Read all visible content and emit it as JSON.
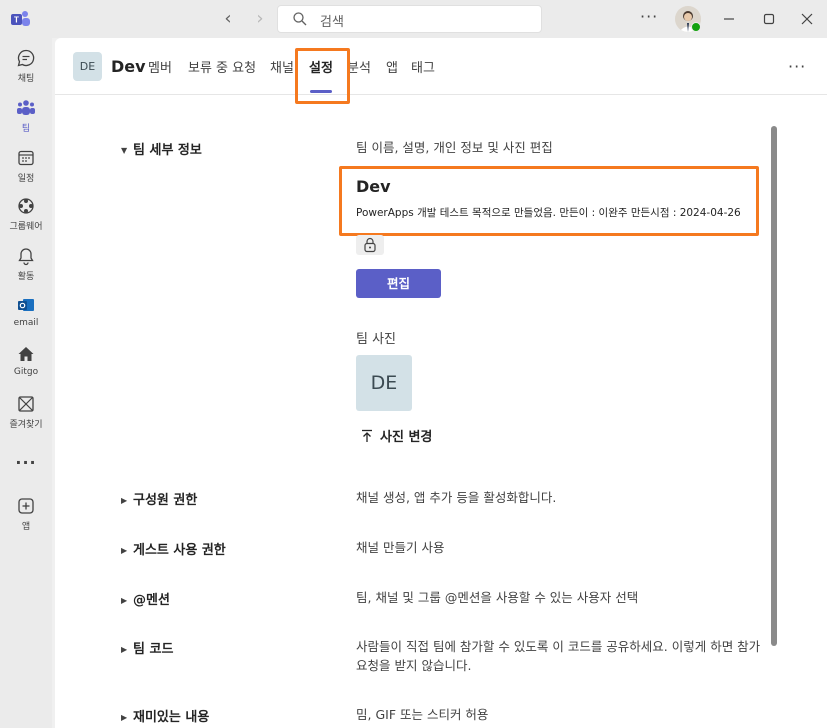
{
  "titlebar": {
    "search_placeholder": "검색",
    "more": "···"
  },
  "rail": {
    "items": [
      {
        "label": "채팅",
        "icon": "chat-icon"
      },
      {
        "label": "팀",
        "icon": "teams-icon"
      },
      {
        "label": "일정",
        "icon": "calendar-icon"
      },
      {
        "label": "그룹웨어",
        "icon": "groupware-icon"
      },
      {
        "label": "활동",
        "icon": "bell-icon"
      },
      {
        "label": "email",
        "icon": "outlook-icon"
      },
      {
        "label": "Gitgo",
        "icon": "home-icon"
      },
      {
        "label": "즐겨찾기",
        "icon": "favorites-icon"
      },
      {
        "label": "···",
        "icon": "more-icon"
      },
      {
        "label": "앱",
        "icon": "add-app-icon"
      }
    ]
  },
  "header": {
    "team_initials": "DE",
    "team_name": "Dev",
    "tabs": [
      {
        "label": "멤버"
      },
      {
        "label": "보류 중 요청"
      },
      {
        "label": "채널"
      },
      {
        "label": "설정"
      },
      {
        "label": "분석"
      },
      {
        "label": "앱"
      },
      {
        "label": "태그"
      }
    ],
    "more": "···"
  },
  "settings": {
    "details": {
      "title": "팀 세부 정보",
      "description": "팀 이름, 설명, 개인 정보 및 사진 편집",
      "team_name": "Dev",
      "team_description": "PowerApps 개발 테스트 목적으로 만들었음. 만든이 : 이완주 만든시점 : 2024-04-26",
      "edit_label": "편집",
      "photo_label": "팀 사진",
      "photo_initials": "DE",
      "change_photo_label": "사진 변경"
    },
    "rows": [
      {
        "title": "구성원 권한",
        "description": "채널 생성, 앱 추가 등을 활성화합니다."
      },
      {
        "title": "게스트 사용 권한",
        "description": "채널 만들기 사용"
      },
      {
        "title": "@멘션",
        "description": "팀, 채널 및 그룹 @멘션을 사용할 수 있는 사용자 선택"
      },
      {
        "title": "팀 코드",
        "description": "사람들이 직접 팀에 참가할 수 있도록 이 코드를 공유하세요. 이렇게 하면 참가 요청을 받지 않습니다."
      },
      {
        "title": "재미있는 내용",
        "description": "밈, GIF 또는 스티커 허용"
      }
    ]
  },
  "colors": {
    "accent": "#5b5fc7",
    "highlight": "#f5791f"
  }
}
